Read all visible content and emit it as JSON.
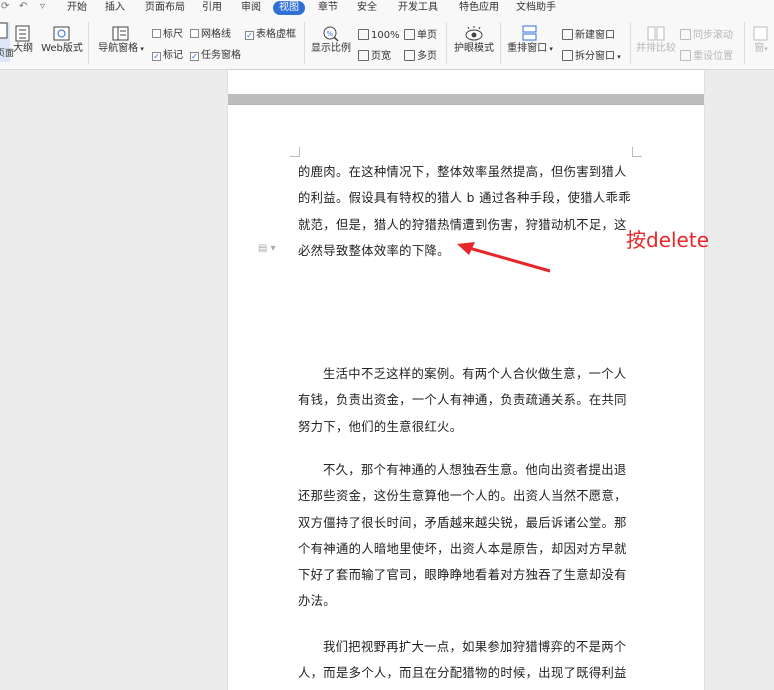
{
  "menu": {
    "tabs": [
      "开始",
      "插入",
      "页面布局",
      "引用",
      "审阅",
      "视图",
      "章节",
      "安全",
      "开发工具",
      "特色应用",
      "文档助手"
    ],
    "active_tab": "视图"
  },
  "ribbon": {
    "page_view": "页面",
    "outline": "大纲",
    "web_layout": "Web版式",
    "nav_pane": "导航窗格",
    "ruler": "标尺",
    "gridlines": "网格线",
    "table_gridlines": "表格虚框",
    "marks": "标记",
    "task_pane": "任务窗格",
    "zoom": "显示比例",
    "zoom_100": "100%",
    "page_width": "页宽",
    "single_page": "单页",
    "multi_page": "多页",
    "eye_mode": "护眼模式",
    "arrange_windows": "重排窗口",
    "new_window": "新建窗口",
    "split_window": "拆分窗口",
    "side_by_side": "并排比较",
    "sync_scroll": "同步滚动",
    "reset_position": "重设位置",
    "more": "窗"
  },
  "document": {
    "paragraphs": [
      "的鹿肉。在这种情况下，整体效率虽然提高，但伤害到猎人的利益。假设具有特权的猎人 b 通过各种手段，使猎人乖乖就范，但是，猎人的狩猎热情遭到伤害，狩猎动机不足，这必然导致整体效率的下降。",
      "生活中不乏这样的案例。有两个人合伙做生意，一个人有钱，负责出资金，一个人有神通，负责疏通关系。在共同努力下，他们的生意很红火。",
      "不久，那个有神通的人想独吞生意。他向出资者提出退还那些资金，这份生意算他一个人的。出资人当然不愿意，双方僵持了很长时间，矛盾越来越尖锐，最后诉诸公堂。那个有神通的人暗地里使坏，出资人本是原告，却因对方早就下好了套而输了官司，眼睁睁地看着对方独吞了生意却没有办法。",
      "我们把视野再扩大一点，如果参加狩猎博弈的不是两个人，而是多个人，而且在分配猎物的时候，出现了既得利益"
    ]
  },
  "annotation": {
    "text": "按delete",
    "color": "#e8262a"
  },
  "colors": {
    "accent": "#2f6fd6",
    "annotation": "#e8262a"
  }
}
